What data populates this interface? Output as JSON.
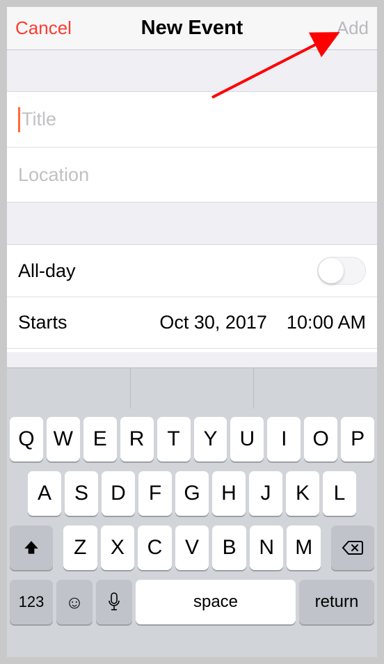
{
  "navbar": {
    "cancel": "Cancel",
    "title": "New Event",
    "add": "Add"
  },
  "fields": {
    "title_placeholder": "Title",
    "location_placeholder": "Location"
  },
  "allday": {
    "label": "All-day",
    "on": false
  },
  "starts": {
    "label": "Starts",
    "date": "Oct 30, 2017",
    "time": "10:00 AM"
  },
  "keyboard": {
    "row1": [
      "Q",
      "W",
      "E",
      "R",
      "T",
      "Y",
      "U",
      "I",
      "O",
      "P"
    ],
    "row2": [
      "A",
      "S",
      "D",
      "F",
      "G",
      "H",
      "J",
      "K",
      "L"
    ],
    "row3": [
      "Z",
      "X",
      "C",
      "V",
      "B",
      "N",
      "M"
    ],
    "numkey": "123",
    "emoji": "☺",
    "space": "space",
    "return": "return"
  }
}
